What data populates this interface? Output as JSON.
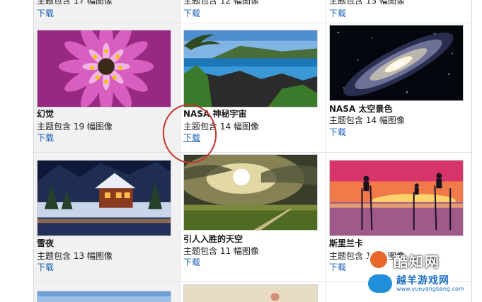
{
  "download_label": "下载",
  "top_partial": [
    {
      "meta": "主题包含 17 幅图像"
    },
    {
      "meta": "主题包含 12 幅图像"
    },
    {
      "meta": "主题包含 13 幅图像"
    }
  ],
  "themes": [
    {
      "title": "幻觉",
      "meta": "主题包含 19 幅图像"
    },
    {
      "title": "NASA 神秘宇宙",
      "meta": "主题包含 14 幅图像"
    },
    {
      "title": "NASA 太空景色",
      "meta": "主题包含 14 幅图像"
    },
    {
      "title": "雪夜",
      "meta": "主题包含 13 幅图像"
    },
    {
      "title": "引人入胜的天空",
      "meta": "主题包含 11 幅图像"
    },
    {
      "title": "斯里兰卡",
      "meta": "主题包含 13 幅图像"
    }
  ],
  "watermark": {
    "name": "酷知网",
    "sub": "越羊游戏网",
    "url": "www.yueyangbang.com"
  },
  "colors": {
    "link": "#1a5fb4",
    "annotation_circle": "#c4352a",
    "grid_line": "#e2e2e2"
  }
}
